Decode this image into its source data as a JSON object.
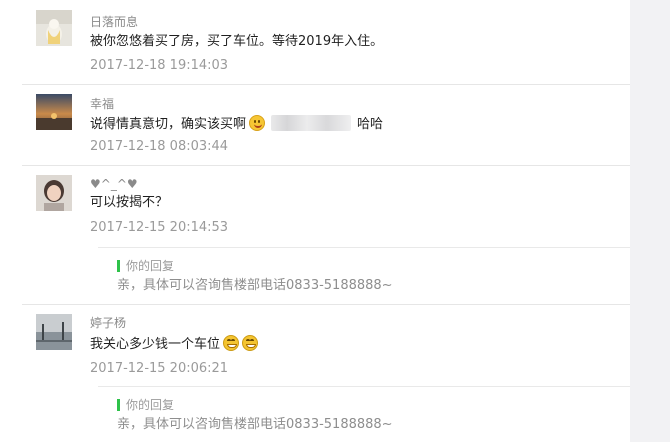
{
  "comments": [
    {
      "name": "日落而息",
      "text": "被你忽悠着买了房，买了车位。等待2019年入住。",
      "time": "2017-12-18 19:14:03",
      "avatar": "avatar-light"
    },
    {
      "name": "幸福",
      "text_before": "说得情真意切，确实该买啊",
      "text_after": "哈哈",
      "time": "2017-12-18 08:03:44",
      "emoji": "smile-emoji",
      "avatar": "avatar-dusk"
    },
    {
      "name": "♥^_^♥",
      "text": "可以按揭不？",
      "time": "2017-12-15 20:14:53",
      "avatar": "avatar-child",
      "reply": {
        "label": "你的回复",
        "text": "亲，具体可以咨询售楼部电话0833-5188888~"
      }
    },
    {
      "name": "婷子杨",
      "text": "我关心多少钱一个车位",
      "time": "2017-12-15 20:06:21",
      "emoji": "grin-emoji",
      "avatar": "avatar-lake",
      "reply": {
        "label": "你的回复",
        "text": "亲，具体可以咨询售楼部电话0833-5188888~"
      }
    }
  ],
  "colors": {
    "reply_accent": "#2ec24a",
    "time": "#9a9a9a",
    "divider": "#e6e6e6"
  }
}
